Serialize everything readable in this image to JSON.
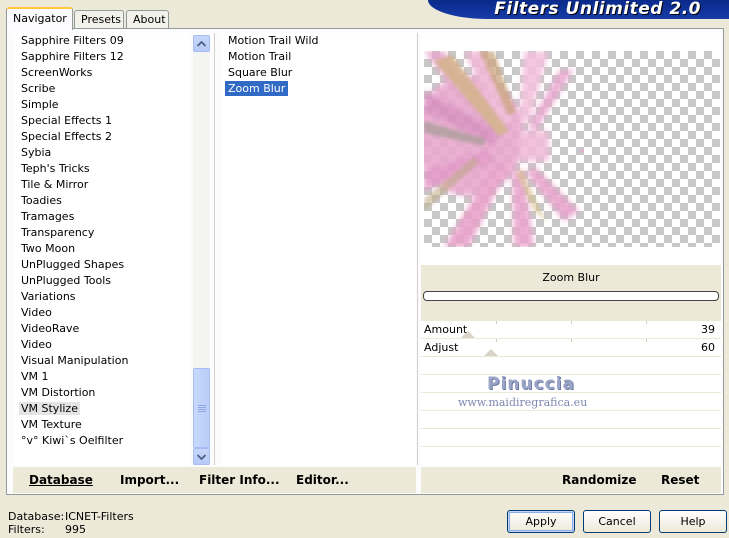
{
  "header": {
    "title": "Filters Unlimited 2.0"
  },
  "tabs": [
    {
      "label": "Navigator",
      "active": true
    },
    {
      "label": "Presets",
      "active": false
    },
    {
      "label": "About",
      "active": false
    }
  ],
  "categories": {
    "items": [
      "Sapphire Filters 09",
      "Sapphire Filters 12",
      "ScreenWorks",
      "Scribe",
      "Simple",
      "Special Effects 1",
      "Special Effects 2",
      "Sybia",
      "Teph's Tricks",
      "Tile & Mirror",
      "Toadies",
      "Tramages",
      "Transparency",
      "Two Moon",
      "UnPlugged Shapes",
      "UnPlugged Tools",
      "Variations",
      "Video",
      "VideoRave",
      "Video",
      "Visual Manipulation",
      "VM 1",
      "VM Distortion",
      "VM Stylize",
      "VM Texture",
      "°v° Kiwi`s Oelfilter"
    ],
    "selected": "VM Stylize"
  },
  "filters": {
    "items": [
      "Motion Trail Wild",
      "Motion Trail",
      "Square Blur",
      "Zoom Blur"
    ],
    "selected": "Zoom Blur"
  },
  "preview": {
    "filter_name": "Zoom Blur"
  },
  "params": [
    {
      "label": "Amount",
      "value": "39"
    },
    {
      "label": "Adjust",
      "value": "60"
    }
  ],
  "watermark": {
    "name": "Pinuccia",
    "url": "www.maidiregrafica.eu"
  },
  "toolbar": {
    "database": "Database",
    "import": "Import...",
    "filter_info": "Filter Info...",
    "editor": "Editor...",
    "randomize": "Randomize",
    "reset": "Reset"
  },
  "status": {
    "database_label": "Database:",
    "database_value": "ICNET-Filters",
    "filters_label": "Filters:",
    "filters_value": "995"
  },
  "dialog": {
    "apply": "Apply",
    "cancel": "Cancel",
    "help": "Help"
  },
  "colors": {
    "selection": "#316ac5",
    "banner": "#0a2a8a",
    "preview_pink": "#e79ccb"
  }
}
